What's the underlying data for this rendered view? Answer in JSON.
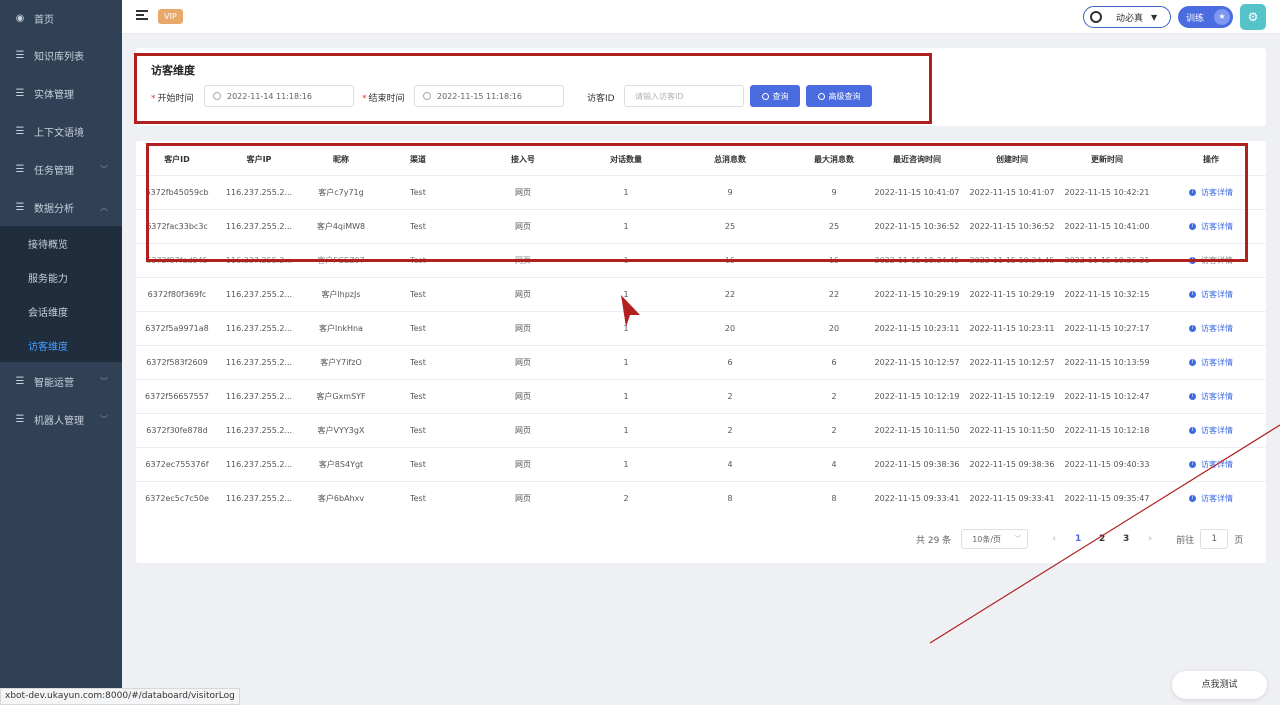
{
  "sidebar": {
    "home": {
      "label": "首页",
      "icon": "dashboard-icon"
    },
    "items": [
      {
        "label": "知识库列表",
        "icon": "list-icon"
      },
      {
        "label": "实体管理",
        "icon": "list-icon"
      },
      {
        "label": "上下文语境",
        "icon": "list-icon"
      },
      {
        "label": "任务管理",
        "icon": "list-icon"
      },
      {
        "label": "数据分析",
        "icon": "list-icon"
      }
    ],
    "submenu": [
      {
        "label": "接待概览"
      },
      {
        "label": "服务能力"
      },
      {
        "label": "会话维度"
      },
      {
        "label": "访客维度",
        "active": true
      }
    ],
    "after": [
      {
        "label": "智能运营",
        "icon": "list-icon"
      },
      {
        "label": "机器人管理",
        "icon": "list-icon"
      }
    ]
  },
  "topbar": {
    "vip": "VIP",
    "user": "动必真",
    "train": "训练"
  },
  "filter": {
    "title": "访客维度",
    "start_label": "开始时间",
    "start_value": "2022-11-14 11:18:16",
    "end_label": "结束时间",
    "end_value": "2022-11-15 11:18:16",
    "visitor_label": "访客ID",
    "visitor_placeholder": "请输入访客ID",
    "query_button": "查询",
    "advanced_button": "高级查询"
  },
  "table": {
    "columns": [
      "客户ID",
      "客户IP",
      "昵称",
      "渠道",
      "接入号",
      "对话数量",
      "总消息数",
      "最大消息数",
      "最近咨询时间",
      "创建时间",
      "更新时间",
      "操作"
    ],
    "op_label": "访客详情",
    "rows": [
      [
        "6372fb45059cb",
        "116.237.255.2...",
        "客户c7y71g",
        "Test",
        "网页",
        "1",
        "9",
        "9",
        "2022-11-15 10:41:07",
        "2022-11-15 10:41:07",
        "2022-11-15 10:42:21"
      ],
      [
        "6372fac33bc3c",
        "116.237.255.2...",
        "客户4qiMW8",
        "Test",
        "网页",
        "1",
        "25",
        "25",
        "2022-11-15 10:36:52",
        "2022-11-15 10:36:52",
        "2022-11-15 10:41:00"
      ],
      [
        "6372f97fad945",
        "116.237.255.2...",
        "客户FGEZ97",
        "Test",
        "网页",
        "1",
        "15",
        "15",
        "2022-11-15 10:34:45",
        "2022-11-15 10:34:45",
        "2022-11-15 10:36:31"
      ],
      [
        "6372f80f369fc",
        "116.237.255.2...",
        "客户lhpzJs",
        "Test",
        "网页",
        "1",
        "22",
        "22",
        "2022-11-15 10:29:19",
        "2022-11-15 10:29:19",
        "2022-11-15 10:32:15"
      ],
      [
        "6372f5a9971a8",
        "116.237.255.2...",
        "客户lnkHna",
        "Test",
        "网页",
        "1",
        "20",
        "20",
        "2022-11-15 10:23:11",
        "2022-11-15 10:23:11",
        "2022-11-15 10:27:17"
      ],
      [
        "6372f583f2609",
        "116.237.255.2...",
        "客户Y7ifzO",
        "Test",
        "网页",
        "1",
        "6",
        "6",
        "2022-11-15 10:12:57",
        "2022-11-15 10:12:57",
        "2022-11-15 10:13:59"
      ],
      [
        "6372f56657557",
        "116.237.255.2...",
        "客户GxmSYF",
        "Test",
        "网页",
        "1",
        "2",
        "2",
        "2022-11-15 10:12:19",
        "2022-11-15 10:12:19",
        "2022-11-15 10:12:47"
      ],
      [
        "6372f30fe878d",
        "116.237.255.2...",
        "客户VYY3gX",
        "Test",
        "网页",
        "1",
        "2",
        "2",
        "2022-11-15 10:11:50",
        "2022-11-15 10:11:50",
        "2022-11-15 10:12:18"
      ],
      [
        "6372ec755376f",
        "116.237.255.2...",
        "客户8S4Ygt",
        "Test",
        "网页",
        "1",
        "4",
        "4",
        "2022-11-15 09:38:36",
        "2022-11-15 09:38:36",
        "2022-11-15 09:40:33"
      ],
      [
        "6372ec5c7c50e",
        "116.237.255.2...",
        "客户6bAhxv",
        "Test",
        "网页",
        "2",
        "8",
        "8",
        "2022-11-15 09:33:41",
        "2022-11-15 09:33:41",
        "2022-11-15 09:35:47"
      ]
    ]
  },
  "pagination": {
    "total": "共 29 条",
    "page_size": "10条/页",
    "pages": [
      "1",
      "2",
      "3"
    ],
    "current": "1",
    "goto_label": "前往",
    "goto_value": "1",
    "goto_suffix": "页"
  },
  "status_url": "xbot-dev.ukayun.com:8000/#/databoard/visitorLog",
  "test_button": "点我测试",
  "colors": {
    "sidebar": "#304156",
    "accent": "#4b6be0",
    "highlight": "#b0201e"
  }
}
